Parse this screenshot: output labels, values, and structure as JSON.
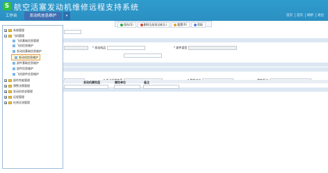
{
  "header": {
    "logo_text": "S",
    "title": "航空活塞发动机维修远程支持系统",
    "links": [
      "首页",
      "首页",
      "刷新",
      "退出"
    ]
  },
  "tabs": [
    {
      "label": "工作台"
    },
    {
      "label": "发动机信息维护"
    }
  ],
  "toolbar": {
    "buttons": [
      {
        "label": "保存(S)",
        "color": "#2aa84a"
      },
      {
        "label": "删除当前发动机(L)",
        "color": "#d2483a"
      },
      {
        "label": "重置(R)",
        "color": "#e3a12a"
      },
      {
        "label": "帮助",
        "color": "#5a7fd8"
      }
    ]
  },
  "form": {
    "engine_label": "* 发动机品",
    "part_type_label": "* 部件类型",
    "engine_attr_label": "* 发动机属性值",
    "attr_unit_label": "* 属性单位",
    "attr_note_label": "属性备注"
  },
  "grid": {
    "headers": [
      "发动机属性值",
      "属性单位",
      "备注"
    ]
  },
  "sidebar": {
    "items": [
      {
        "label": "系统管理",
        "type": "folder",
        "expanded": false
      },
      {
        "label": "飞机管理",
        "type": "folder",
        "expanded": true
      },
      {
        "label": "飞机基础信息管理",
        "type": "leaf"
      },
      {
        "label": "飞机信息维护",
        "type": "leaf"
      },
      {
        "label": "发动机基础信息维护",
        "type": "leaf"
      },
      {
        "label": "发动机信息维护",
        "type": "leaf",
        "selected": true
      },
      {
        "label": "部件基础信息维护",
        "type": "leaf"
      },
      {
        "label": "部件信息维护",
        "type": "leaf"
      },
      {
        "label": "飞机部件信息维护",
        "type": "leaf"
      },
      {
        "label": "部件性能管理",
        "type": "folder",
        "expanded": false
      },
      {
        "label": "预警决策管理",
        "type": "folder",
        "expanded": false
      },
      {
        "label": "发动机状态管理",
        "type": "folder",
        "expanded": false
      },
      {
        "label": "远程管理",
        "type": "folder",
        "expanded": false
      },
      {
        "label": "在线交流管理",
        "type": "folder",
        "expanded": false
      }
    ]
  }
}
